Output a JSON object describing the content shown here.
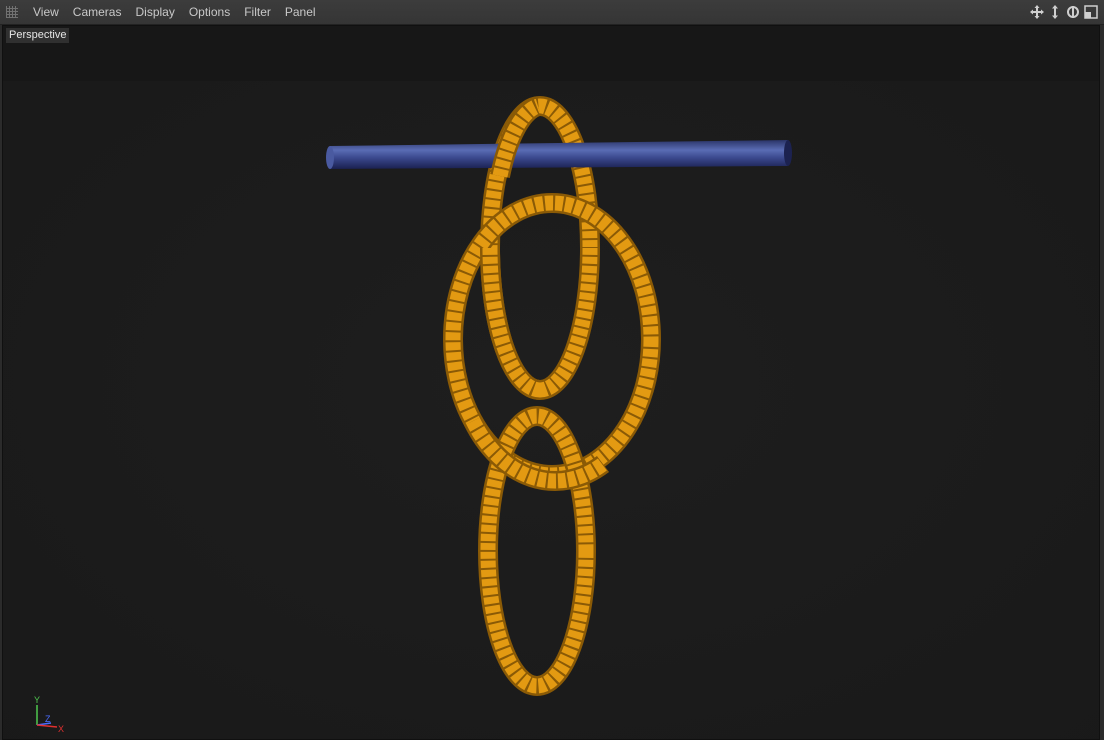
{
  "menu": {
    "items": [
      {
        "id": "view",
        "label": "View"
      },
      {
        "id": "cameras",
        "label": "Cameras"
      },
      {
        "id": "display",
        "label": "Display"
      },
      {
        "id": "options",
        "label": "Options"
      },
      {
        "id": "filter",
        "label": "Filter"
      },
      {
        "id": "panel",
        "label": "Panel"
      }
    ],
    "nav_icons": [
      "move-view-icon",
      "zoom-view-icon",
      "rotate-view-icon",
      "maximize-view-icon"
    ]
  },
  "viewport": {
    "camera_label": "Perspective",
    "background": "#1c1c1c"
  },
  "scene": {
    "bar_color": "#3a4a8c",
    "ring_color": "#e39a12",
    "ring_shadow": "#8a5a06"
  },
  "axis": {
    "y_label": "Y",
    "z_label": "Z",
    "x_label": "X",
    "y_color": "#4fc84f",
    "z_color": "#4a6cff",
    "x_color": "#e03030"
  }
}
